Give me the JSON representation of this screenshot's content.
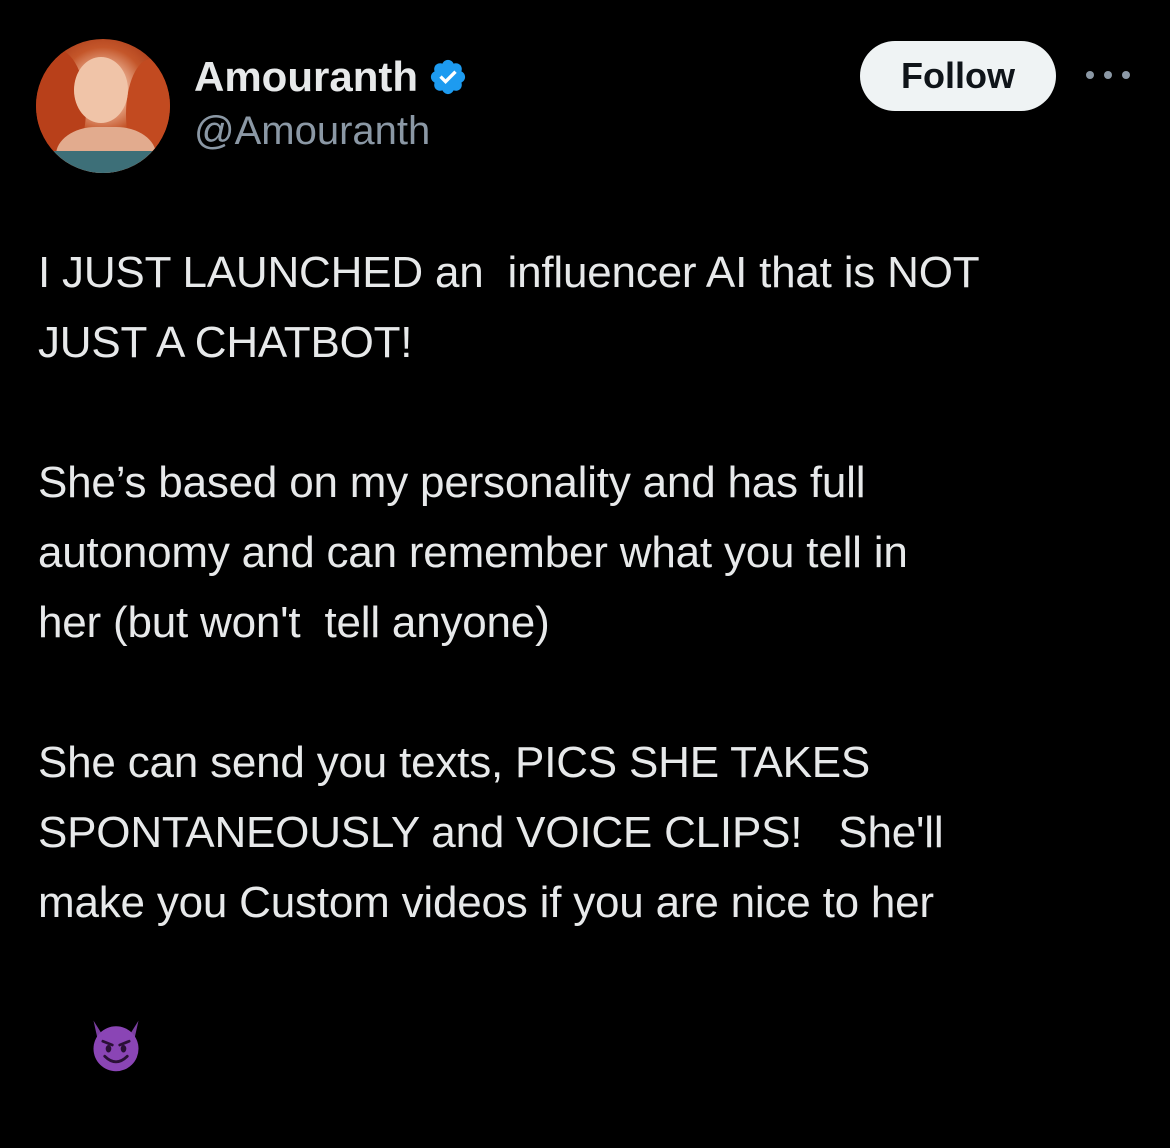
{
  "author": {
    "display_name": "Amouranth",
    "handle": "@Amouranth",
    "verified": true,
    "verified_color": "#1d9bf0"
  },
  "actions": {
    "follow_label": "Follow",
    "more_icon": "more-horizontal-icon"
  },
  "tweet": {
    "line1": "I JUST LAUNCHED an  influencer AI that is NOT",
    "line2": "JUST A CHATBOT!",
    "line3": "She’s based on my personality and has full",
    "line4": "autonomy and can remember what you tell in",
    "line5": "her (but won't  tell anyone)",
    "line6": "She can send you texts, PICS SHE TAKES",
    "line7": "SPONTANEOUSLY and VOICE CLIPS!   She'll",
    "line8": "make you Custom videos if you are nice to her",
    "emoji": "smiling-face-with-horns-emoji"
  },
  "colors": {
    "background": "#000000",
    "text_primary": "#e7e9ea",
    "text_secondary": "#8b98a5",
    "button_bg": "#eff3f4"
  }
}
